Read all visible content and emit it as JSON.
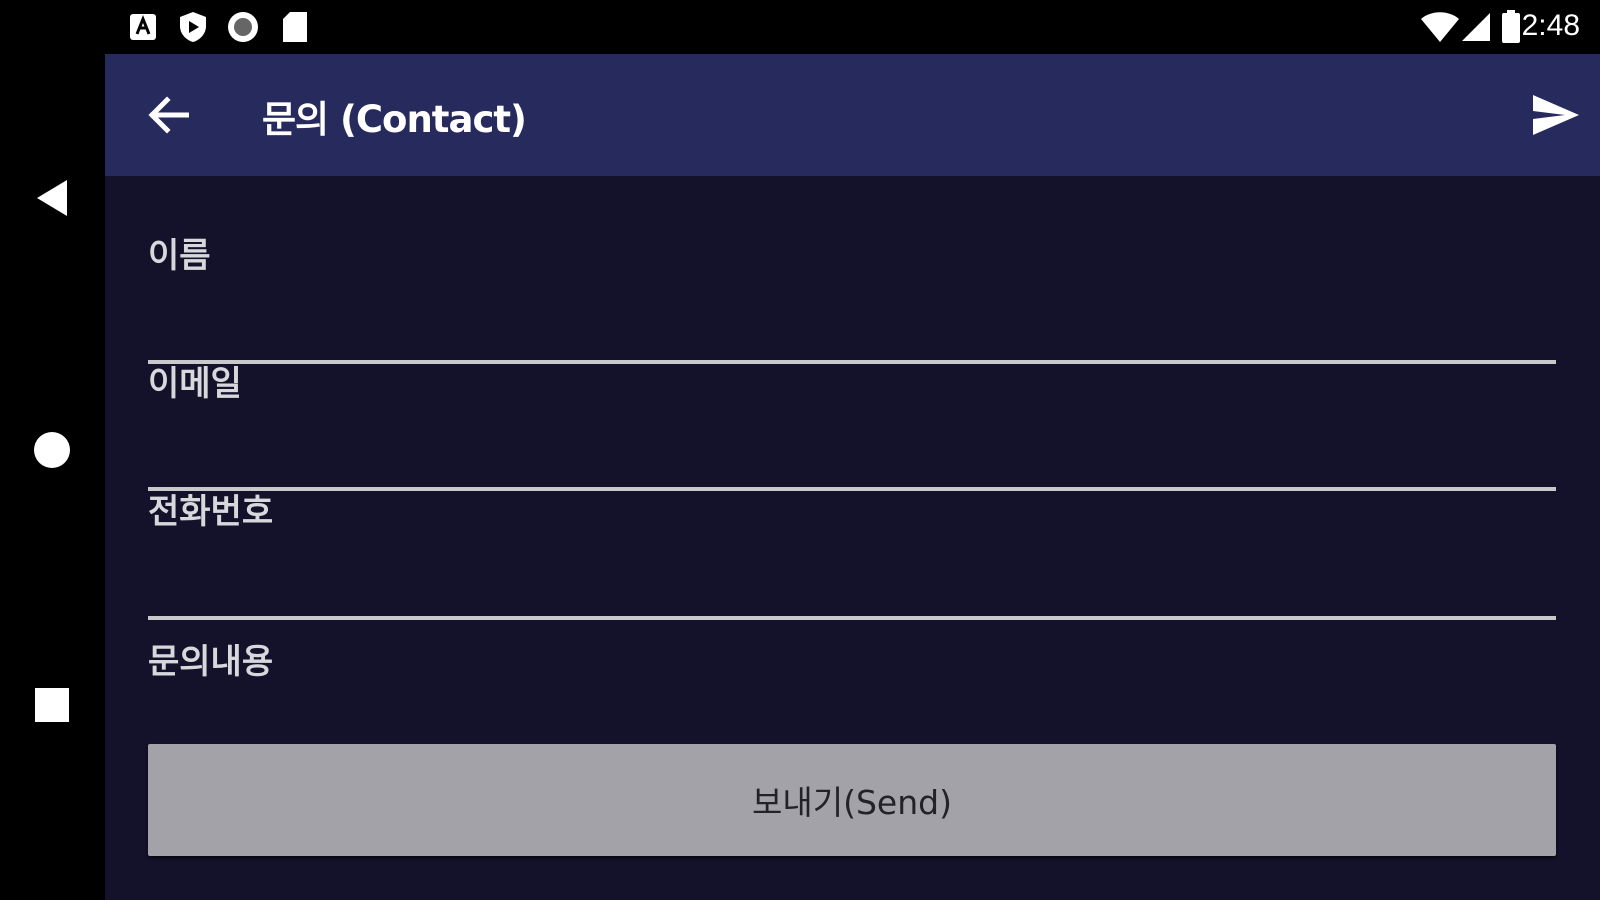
{
  "status_bar": {
    "left_icons": [
      "a-notification-icon",
      "shield-play-icon",
      "record-icon",
      "sd-card-icon"
    ],
    "right_icons": [
      "wifi-icon",
      "cell-signal-icon",
      "battery-icon"
    ],
    "time": "2:48"
  },
  "navigation_bar": {
    "buttons": [
      "back-triangle-icon",
      "home-circle-icon",
      "recents-square-icon"
    ]
  },
  "app_bar": {
    "title": "문의 (Contact)",
    "back_icon": "arrow-left-icon",
    "send_icon": "send-icon"
  },
  "form": {
    "fields": [
      {
        "label": "이름"
      },
      {
        "label": "이메일"
      },
      {
        "label": "전화번호"
      },
      {
        "label": "문의내용"
      }
    ],
    "send_button": "보내기(Send)"
  },
  "colors": {
    "app_bar": "#272a5c",
    "content_bg": "#13122a",
    "button": "#a3a2a8"
  }
}
